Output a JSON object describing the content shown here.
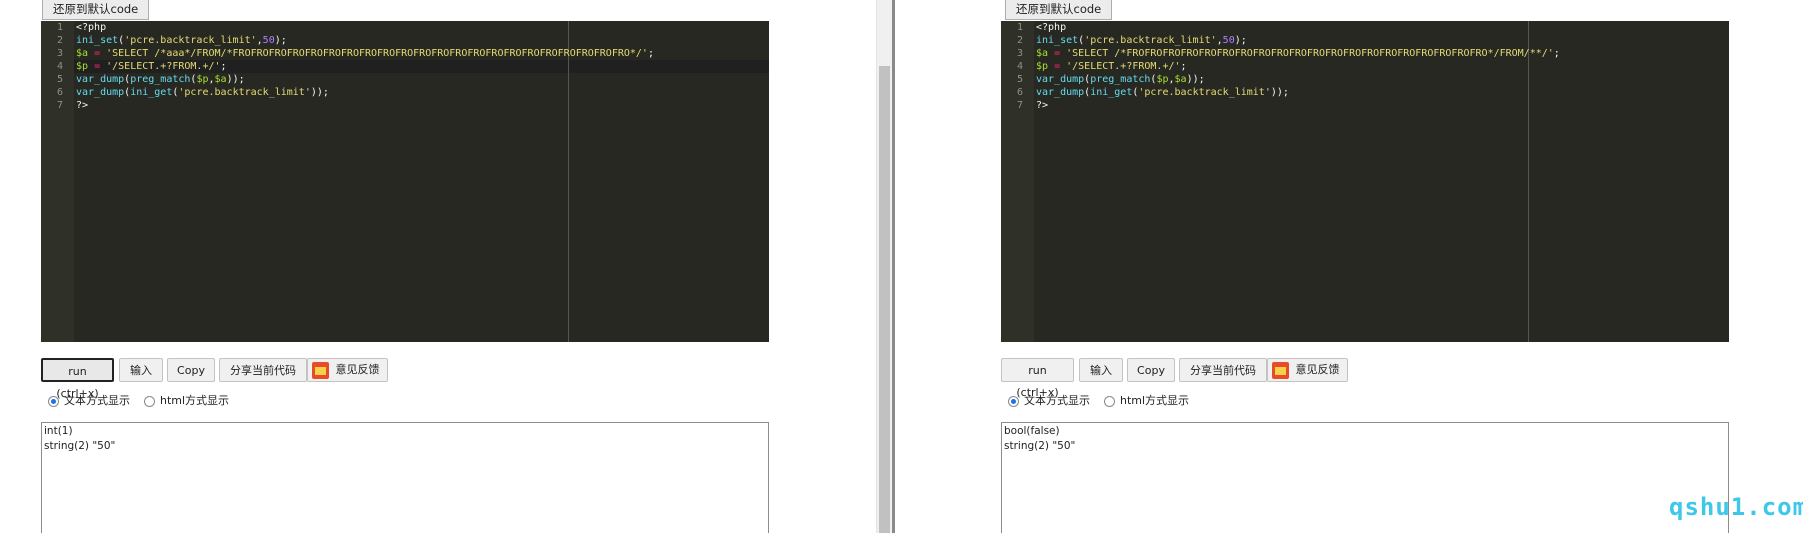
{
  "reset_label": "还原到默认code",
  "line_numbers": [
    "1",
    "2",
    "3",
    "4",
    "5",
    "6",
    "7"
  ],
  "panes": {
    "left": {
      "code": {
        "l1": "<?php",
        "l2_fn": "ini_set",
        "l2_open": "(",
        "l2_str": "'pcre.backtrack_limit'",
        "l2_comma": ",",
        "l2_num": "50",
        "l2_close": ");",
        "l3_var": "$a",
        "l3_eq": " = ",
        "l3_str": "'SELECT /*aaa*/FROM/*FROFROFROFROFROFROFROFROFROFROFROFROFROFROFROFROFROFROFROFROFROFRO*/'",
        "l3_end": ";",
        "l4_var": "$p",
        "l4_eq": " = ",
        "l4_str": "'/SELECT.+?FROM.+/'",
        "l4_end": ";",
        "l5_fn1": "var_dump",
        "l5_a": "(",
        "l5_fn2": "preg_match",
        "l5_b": "(",
        "l5_v1": "$p",
        "l5_c": ",",
        "l5_v2": "$a",
        "l5_d": "));",
        "l6_fn1": "var_dump",
        "l6_a": "(",
        "l6_fn2": "ini_get",
        "l6_b": "(",
        "l6_str": "'pcre.backtrack_limit'",
        "l6_c": "));",
        "l7": "?>"
      },
      "output": [
        "int(1)",
        "string(2) \"50\""
      ]
    },
    "right": {
      "code": {
        "l1": "<?php",
        "l2_fn": "ini_set",
        "l2_open": "(",
        "l2_str": "'pcre.backtrack_limit'",
        "l2_comma": ",",
        "l2_num": "50",
        "l2_close": ");",
        "l3_var": "$a",
        "l3_eq": " = ",
        "l3_str": "'SELECT /*FROFROFROFROFROFROFROFROFROFROFROFROFROFROFROFROFROFROFROFRO*/FROM/**/'",
        "l3_end": ";",
        "l4_var": "$p",
        "l4_eq": " = ",
        "l4_str": "'/SELECT.+?FROM.+/'",
        "l4_end": ";",
        "l5_fn1": "var_dump",
        "l5_a": "(",
        "l5_fn2": "preg_match",
        "l5_b": "(",
        "l5_v1": "$p",
        "l5_c": ",",
        "l5_v2": "$a",
        "l5_d": "));",
        "l6_fn1": "var_dump",
        "l6_a": "(",
        "l6_fn2": "ini_get",
        "l6_b": "(",
        "l6_str": "'pcre.backtrack_limit'",
        "l6_c": "));",
        "l7": "?>"
      },
      "output": [
        "bool(false)",
        "string(2) \"50\""
      ]
    }
  },
  "toolbar": {
    "run": "run (ctrl+x)",
    "input": "输入",
    "copy": "Copy",
    "share": "分享当前代码",
    "feedback": "意见反馈",
    "feedback_icon": "mail-icon"
  },
  "radio": {
    "text_mode": "文本方式显示",
    "html_mode": "html方式显示"
  },
  "colors": {
    "editor_bg": "#272822",
    "function": "#66d9ef",
    "string": "#e6db74",
    "number": "#ae81ff",
    "variable": "#a6e22e",
    "operator": "#f92672",
    "watermark": "#3dc7e8"
  },
  "watermark": "qshu1.com"
}
